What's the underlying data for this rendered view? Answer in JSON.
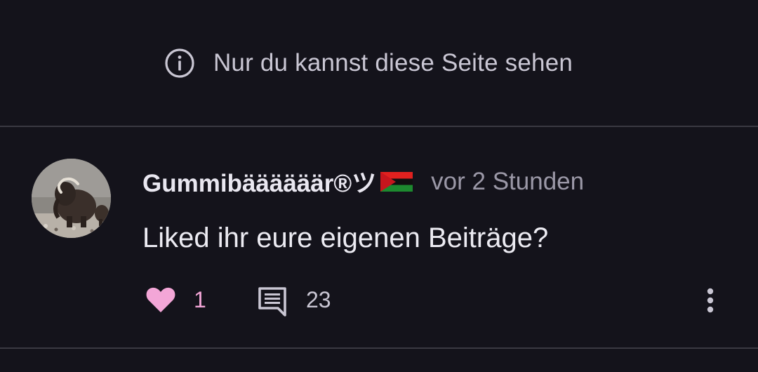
{
  "notice": {
    "icon": "info-icon",
    "text": "Nur du kannst diese Seite sehen"
  },
  "post": {
    "avatar_icon": "mammoth-avatar",
    "username": "Gummibäääääär®ツ",
    "flag_icon": "flag-icon",
    "timestamp": "vor 2 Stunden",
    "text": "Liked ihr eure eigenen Beiträge?",
    "likes": "1",
    "comments": "23",
    "like_icon": "heart-icon",
    "comment_icon": "comment-icon",
    "more_icon": "more-vertical-icon",
    "colors": {
      "like": "#f3a6d7",
      "background": "#14131b",
      "divider": "#3a3942",
      "muted": "#9b98a7"
    }
  }
}
